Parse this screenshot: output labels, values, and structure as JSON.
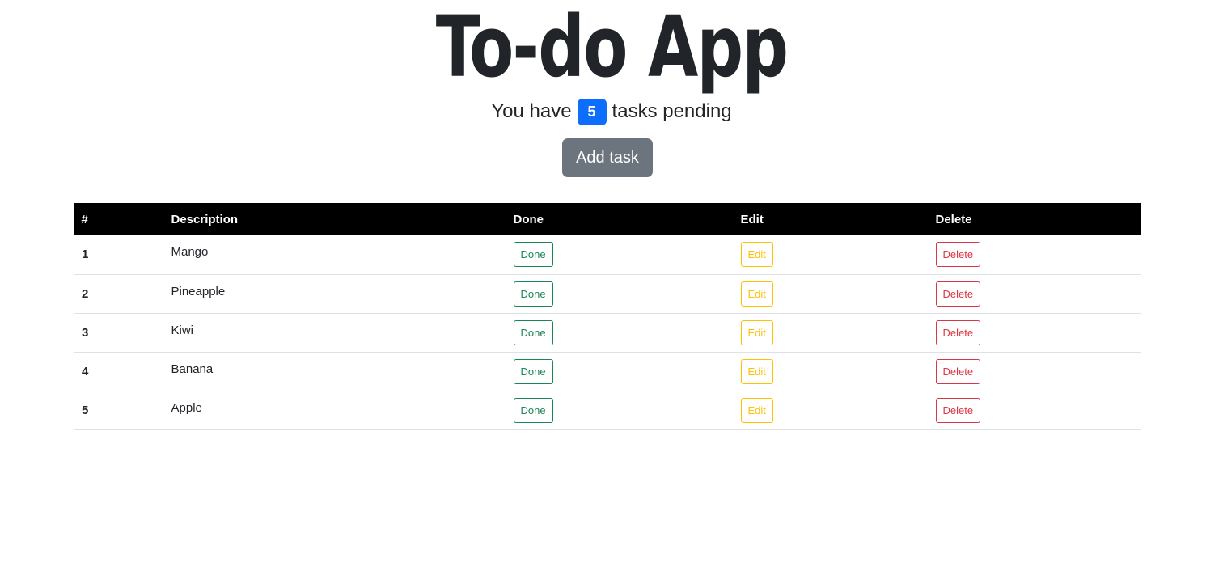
{
  "title": "To-do App",
  "pending": {
    "prefix": "You have",
    "count": "5",
    "suffix": "tasks pending"
  },
  "add_task_label": "Add task",
  "table": {
    "headers": [
      "#",
      "Description",
      "Done",
      "Edit",
      "Delete"
    ],
    "rows": [
      {
        "num": "1",
        "description": "Mango",
        "done": "Done",
        "edit": "Edit",
        "delete": "Delete"
      },
      {
        "num": "2",
        "description": "Pineapple",
        "done": "Done",
        "edit": "Edit",
        "delete": "Delete"
      },
      {
        "num": "3",
        "description": "Kiwi",
        "done": "Done",
        "edit": "Edit",
        "delete": "Delete"
      },
      {
        "num": "4",
        "description": "Banana",
        "done": "Done",
        "edit": "Edit",
        "delete": "Delete"
      },
      {
        "num": "5",
        "description": "Apple",
        "done": "Done",
        "edit": "Edit",
        "delete": "Delete"
      }
    ]
  },
  "colors": {
    "badge": "#0d6efd",
    "add_button": "#6c757d",
    "header_bg": "#000000",
    "done": "#198754",
    "edit": "#ffc107",
    "delete": "#dc3545"
  }
}
